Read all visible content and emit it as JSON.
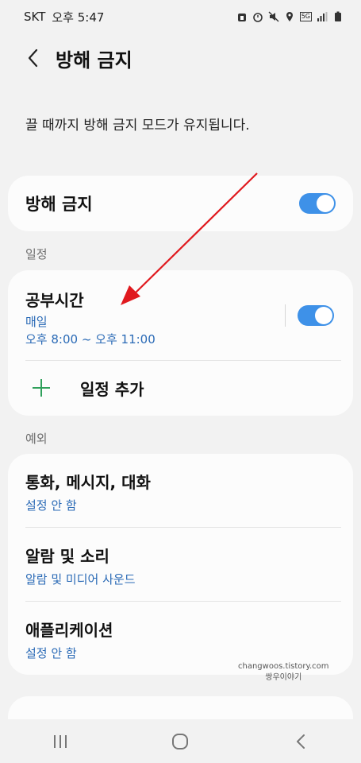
{
  "status_bar": {
    "carrier": "SKT",
    "time": "오후 5:47",
    "icons": [
      "alarm-icon",
      "mute-icon",
      "location-icon",
      "network-5g-icon",
      "signal-icon",
      "battery-icon"
    ],
    "network_label": "5G"
  },
  "header": {
    "title": "방해 금지",
    "back_icon": "chevron-left-icon"
  },
  "description": "끌 때까지 방해 금지 모드가 유지됩니다.",
  "dnd": {
    "label": "방해 금지",
    "enabled": true
  },
  "schedule_section": {
    "label": "일정",
    "items": [
      {
        "name": "공부시간",
        "days": "매일",
        "time": "오후 8:00 ~ 오후 11:00",
        "enabled": true
      }
    ],
    "add_label": "일정 추가"
  },
  "exceptions_section": {
    "label": "예외",
    "items": [
      {
        "title": "통화, 메시지, 대화",
        "subtitle": "설정 안 함"
      },
      {
        "title": "알람 및 소리",
        "subtitle": "알람 및 미디어 사운드"
      },
      {
        "title": "애플리케이션",
        "subtitle": "설정 안 함"
      }
    ]
  },
  "watermark": {
    "line1": "changwoos.tistory.com",
    "line2": "쌍우이야기"
  },
  "colors": {
    "accent": "#3e91e8",
    "link_blue": "#2a6ab6",
    "add_green": "#2fa05b",
    "annotation_red": "#e0191e",
    "background": "#f2f2f2",
    "card": "#fcfcfc"
  },
  "nav_bar": {
    "icons": [
      "recent-apps-icon",
      "home-icon",
      "back-icon"
    ]
  }
}
